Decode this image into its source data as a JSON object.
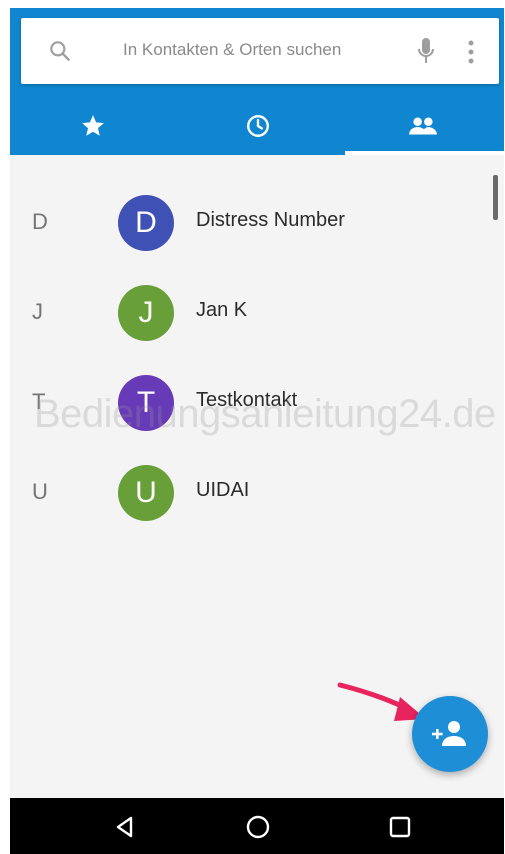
{
  "search": {
    "placeholder": "In Kontakten & Orten suchen",
    "search_icon": "search-icon",
    "mic_icon": "mic-icon",
    "more_icon": "more-vert-icon"
  },
  "tabs": [
    {
      "icon": "star-icon",
      "label": "Favorites"
    },
    {
      "icon": "clock-icon",
      "label": "Recent"
    },
    {
      "icon": "people-icon",
      "label": "Contacts",
      "selected": true
    }
  ],
  "contacts": [
    {
      "letter": "D",
      "initial": "D",
      "name": "Distress Number",
      "color": "#3f51b5"
    },
    {
      "letter": "J",
      "initial": "J",
      "name": "Jan K",
      "color": "#689f38"
    },
    {
      "letter": "T",
      "initial": "T",
      "name": "Testkontakt",
      "color": "#673ab7"
    },
    {
      "letter": "U",
      "initial": "U",
      "name": "UIDAI",
      "color": "#689f38"
    }
  ],
  "watermark": "Bedienungsanleitung24.de",
  "fab": {
    "icon": "add-contact-icon",
    "color": "#1e8fd6"
  },
  "colors": {
    "header": "#0f86cf",
    "arrow": "#e8245e",
    "list_background": "#f4f4f4"
  },
  "navbar": {
    "back_icon": "back-icon",
    "home_icon": "home-icon",
    "recents_icon": "recents-icon"
  }
}
